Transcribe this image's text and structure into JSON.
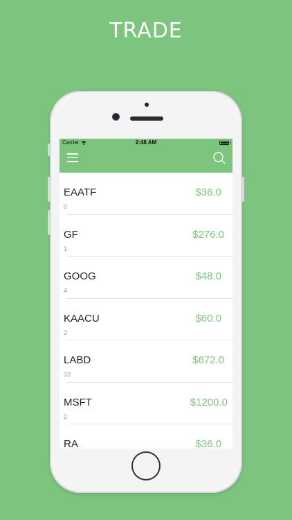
{
  "hero": {
    "title": "TRADE"
  },
  "status_bar": {
    "carrier": "Carrier",
    "time": "2:48 AM"
  },
  "colors": {
    "brand_green": "#7dc57f",
    "price_green": "#7dc57f"
  },
  "nav": {
    "left_icon": "menu-icon",
    "right_icon": "search-icon"
  },
  "stocks": [
    {
      "symbol": "EAATF",
      "quantity": "0",
      "price": "$36.0"
    },
    {
      "symbol": "GF",
      "quantity": "1",
      "price": "$276.0"
    },
    {
      "symbol": "GOOG",
      "quantity": "4",
      "price": "$48.0"
    },
    {
      "symbol": "KAACU",
      "quantity": "2",
      "price": "$60.0"
    },
    {
      "symbol": "LABD",
      "quantity": "33",
      "price": "$672.0"
    },
    {
      "symbol": "MSFT",
      "quantity": "2",
      "price": "$1200.0"
    },
    {
      "symbol": "RA",
      "quantity": "",
      "price": "$36.0"
    }
  ]
}
